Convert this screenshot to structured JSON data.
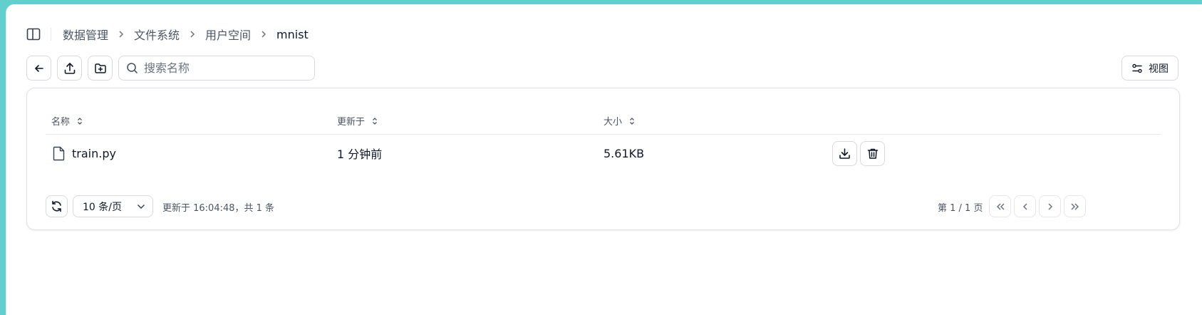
{
  "breadcrumb": {
    "items": [
      "数据管理",
      "文件系统",
      "用户空间"
    ],
    "current": "mnist"
  },
  "toolbar": {
    "search_placeholder": "搜索名称",
    "search_value": "",
    "view_label": "视图"
  },
  "table": {
    "columns": [
      "名称",
      "更新于",
      "大小"
    ],
    "rows": [
      {
        "name": "train.py",
        "updated": "1 分钟前",
        "size": "5.61KB"
      }
    ]
  },
  "footer": {
    "page_size": "10 条/页",
    "updated_text": "更新于 16:04:48，共 1 条",
    "page_info": "第 1 / 1 页"
  },
  "colors": {
    "accent_border": "#62cfcf",
    "border": "#d7dbe0",
    "text": "#111827",
    "muted": "#4b5563"
  }
}
